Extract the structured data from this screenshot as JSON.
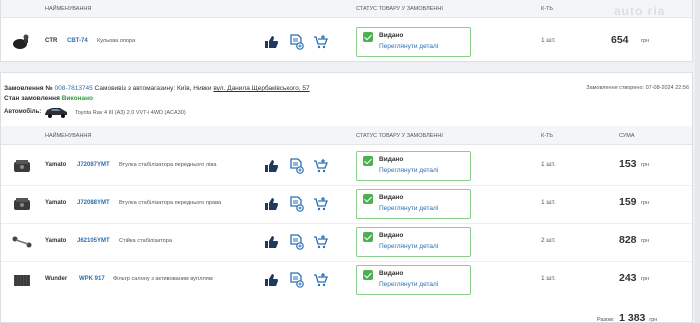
{
  "columns": {
    "name": "НАЙМЕНУВАННЯ",
    "status": "СТАТУС ТОВАРУ У ЗАМОВЛЕННІ",
    "qty": "К-ТЬ",
    "sum": "СУМА"
  },
  "watermark": "auto ria",
  "top_order": {
    "item": {
      "brand": "CTR",
      "article": "CBT-74",
      "name": "Кульова опора",
      "status": "Видано",
      "status_link": "Переглянути деталі",
      "qty": "1 шт.",
      "price": "654",
      "currency": "грн"
    }
  },
  "order": {
    "label": "Замовлення №",
    "number": "008-7813745",
    "delivery": "Самовивіз з автомагазину: Київ, Нивки",
    "address": "вул. Данила Щербаківського, 57",
    "created": "Замовлення створено: 07-08-2024 22:56",
    "state_label": "Стан замовлення",
    "state_value": "Виконано",
    "car_label": "Автомобіль:",
    "car_name": "Toyota Rav 4 III (A3) 2.0 VVT-i 4WD (ACA30)",
    "items": [
      {
        "brand": "Yamato",
        "article": "J72087YMT",
        "name": "Втулка стабілізатора переднього лівa",
        "status": "Видано",
        "status_link": "Переглянути деталі",
        "qty": "1 шт.",
        "price": "153",
        "currency": "грн"
      },
      {
        "brand": "Yamato",
        "article": "J72088YMT",
        "name": "Втулка стабілізатора переднього права",
        "status": "Видано",
        "status_link": "Переглянути деталі",
        "qty": "1 шт.",
        "price": "159",
        "currency": "грн"
      },
      {
        "brand": "Yamato",
        "article": "J62105YMT",
        "name": "Стійка стабілізатора",
        "status": "Видано",
        "status_link": "Переглянути деталі",
        "qty": "2 шт.",
        "price": "828",
        "currency": "грн"
      },
      {
        "brand": "Wunder",
        "article": "WPK 917",
        "name": "Фільтр салону з активованим вугіллям",
        "status": "Видано",
        "status_link": "Переглянути деталі",
        "qty": "1 шт.",
        "price": "243",
        "currency": "грн"
      }
    ],
    "total_label": "Разом:",
    "total_value": "1 383",
    "total_currency": "грн"
  },
  "colors": {
    "accent": "#2a6fb3",
    "success": "#4caf50",
    "done": "#2f9a3a"
  }
}
